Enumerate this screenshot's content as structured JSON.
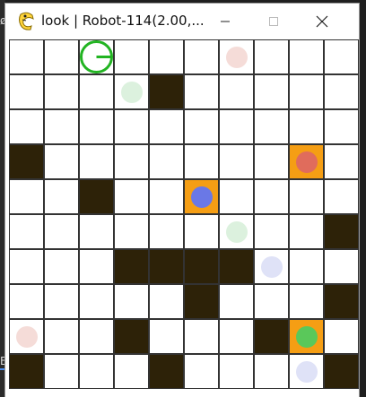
{
  "window": {
    "title": "look | Robot-114(2.00,...",
    "controls": [
      "minimize",
      "maximize",
      "close"
    ]
  },
  "grid": {
    "rows": 10,
    "cols": 10,
    "cells": [
      [
        "empty",
        "empty",
        "empty",
        "empty",
        "empty",
        "empty",
        "empty",
        "empty",
        "empty",
        "empty"
      ],
      [
        "empty",
        "empty",
        "empty",
        "empty",
        "wall",
        "empty",
        "empty",
        "empty",
        "empty",
        "empty"
      ],
      [
        "empty",
        "empty",
        "empty",
        "empty",
        "empty",
        "empty",
        "empty",
        "empty",
        "empty",
        "empty"
      ],
      [
        "wall",
        "empty",
        "empty",
        "empty",
        "empty",
        "empty",
        "empty",
        "empty",
        "marked",
        "empty"
      ],
      [
        "empty",
        "empty",
        "wall",
        "empty",
        "empty",
        "marked",
        "empty",
        "empty",
        "empty",
        "empty"
      ],
      [
        "empty",
        "empty",
        "empty",
        "empty",
        "empty",
        "empty",
        "empty",
        "empty",
        "empty",
        "wall"
      ],
      [
        "empty",
        "empty",
        "empty",
        "wall",
        "wall",
        "wall",
        "wall",
        "empty",
        "empty",
        "empty"
      ],
      [
        "empty",
        "empty",
        "empty",
        "empty",
        "empty",
        "wall",
        "empty",
        "empty",
        "empty",
        "wall"
      ],
      [
        "empty",
        "empty",
        "empty",
        "wall",
        "empty",
        "empty",
        "empty",
        "wall",
        "marked",
        "empty"
      ],
      [
        "wall",
        "empty",
        "empty",
        "empty",
        "wall",
        "empty",
        "empty",
        "empty",
        "empty",
        "wall"
      ]
    ],
    "robot": {
      "row": 0,
      "col": 2,
      "heading": "east",
      "color": "#22b422"
    },
    "objects": [
      {
        "row": 0,
        "col": 6,
        "color": "#f5dcd8",
        "kind": "faint"
      },
      {
        "row": 1,
        "col": 3,
        "color": "#dcf1de",
        "kind": "faint"
      },
      {
        "row": 3,
        "col": 8,
        "color": "#e06c5c",
        "kind": "solid"
      },
      {
        "row": 4,
        "col": 5,
        "color": "#6a78e6",
        "kind": "solid"
      },
      {
        "row": 5,
        "col": 6,
        "color": "#dcf1de",
        "kind": "faint"
      },
      {
        "row": 6,
        "col": 7,
        "color": "#dfe2f7",
        "kind": "faint"
      },
      {
        "row": 8,
        "col": 0,
        "color": "#f5dcd8",
        "kind": "faint"
      },
      {
        "row": 8,
        "col": 8,
        "color": "#5ac85a",
        "kind": "solid"
      },
      {
        "row": 9,
        "col": 8,
        "color": "#dfe2f7",
        "kind": "faint"
      }
    ]
  },
  "colors": {
    "wall": "#2d2208",
    "marked": "#f59e14",
    "grid_line": "#333333"
  }
}
